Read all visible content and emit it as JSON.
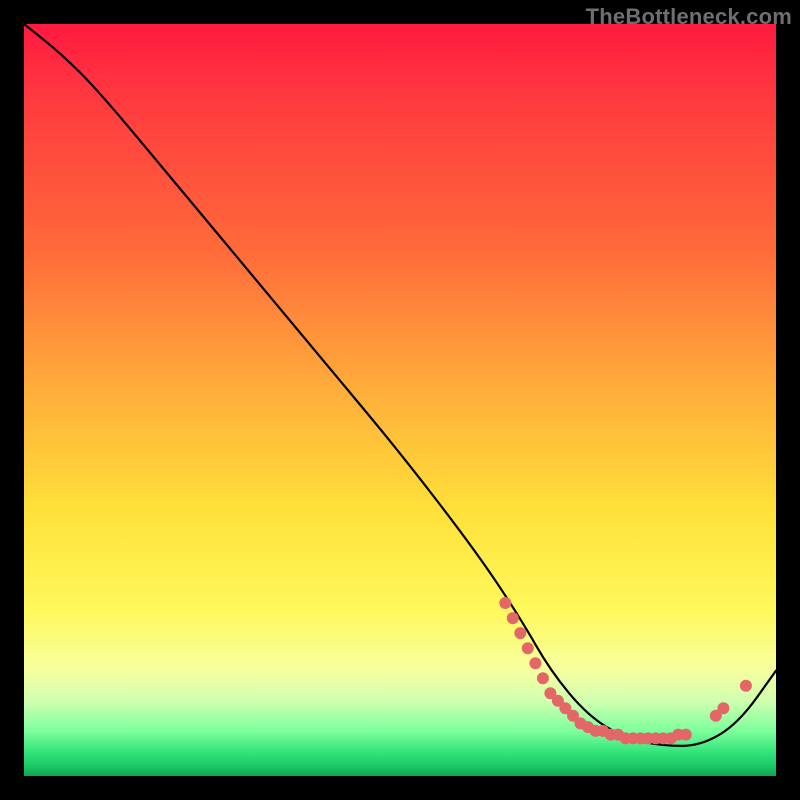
{
  "watermark": "TheBottleneck.com",
  "chart_data": {
    "type": "line",
    "title": "",
    "xlabel": "",
    "ylabel": "",
    "xlim": [
      0,
      100
    ],
    "ylim": [
      0,
      100
    ],
    "series": [
      {
        "name": "curve",
        "x": [
          0,
          5,
          10,
          20,
          30,
          40,
          50,
          60,
          66,
          70,
          75,
          80,
          85,
          90,
          95,
          100
        ],
        "y": [
          100,
          96,
          91,
          79,
          67,
          55,
          43,
          30,
          21,
          14,
          8,
          5,
          4,
          4,
          7,
          14
        ]
      }
    ],
    "markers": [
      {
        "x": 64,
        "y": 23
      },
      {
        "x": 65,
        "y": 21
      },
      {
        "x": 66,
        "y": 19
      },
      {
        "x": 67,
        "y": 17
      },
      {
        "x": 68,
        "y": 15
      },
      {
        "x": 69,
        "y": 13
      },
      {
        "x": 70,
        "y": 11
      },
      {
        "x": 71,
        "y": 10
      },
      {
        "x": 72,
        "y": 9
      },
      {
        "x": 73,
        "y": 8
      },
      {
        "x": 74,
        "y": 7
      },
      {
        "x": 75,
        "y": 6.5
      },
      {
        "x": 76,
        "y": 6
      },
      {
        "x": 77,
        "y": 6
      },
      {
        "x": 78,
        "y": 5.5
      },
      {
        "x": 79,
        "y": 5.5
      },
      {
        "x": 80,
        "y": 5
      },
      {
        "x": 81,
        "y": 5
      },
      {
        "x": 82,
        "y": 5
      },
      {
        "x": 83,
        "y": 5
      },
      {
        "x": 84,
        "y": 5
      },
      {
        "x": 85,
        "y": 5
      },
      {
        "x": 86,
        "y": 5
      },
      {
        "x": 87,
        "y": 5.5
      },
      {
        "x": 88,
        "y": 5.5
      },
      {
        "x": 92,
        "y": 8
      },
      {
        "x": 93,
        "y": 9
      },
      {
        "x": 96,
        "y": 12
      }
    ],
    "colors": {
      "curve": "#000000",
      "markers": "#e36767"
    }
  }
}
